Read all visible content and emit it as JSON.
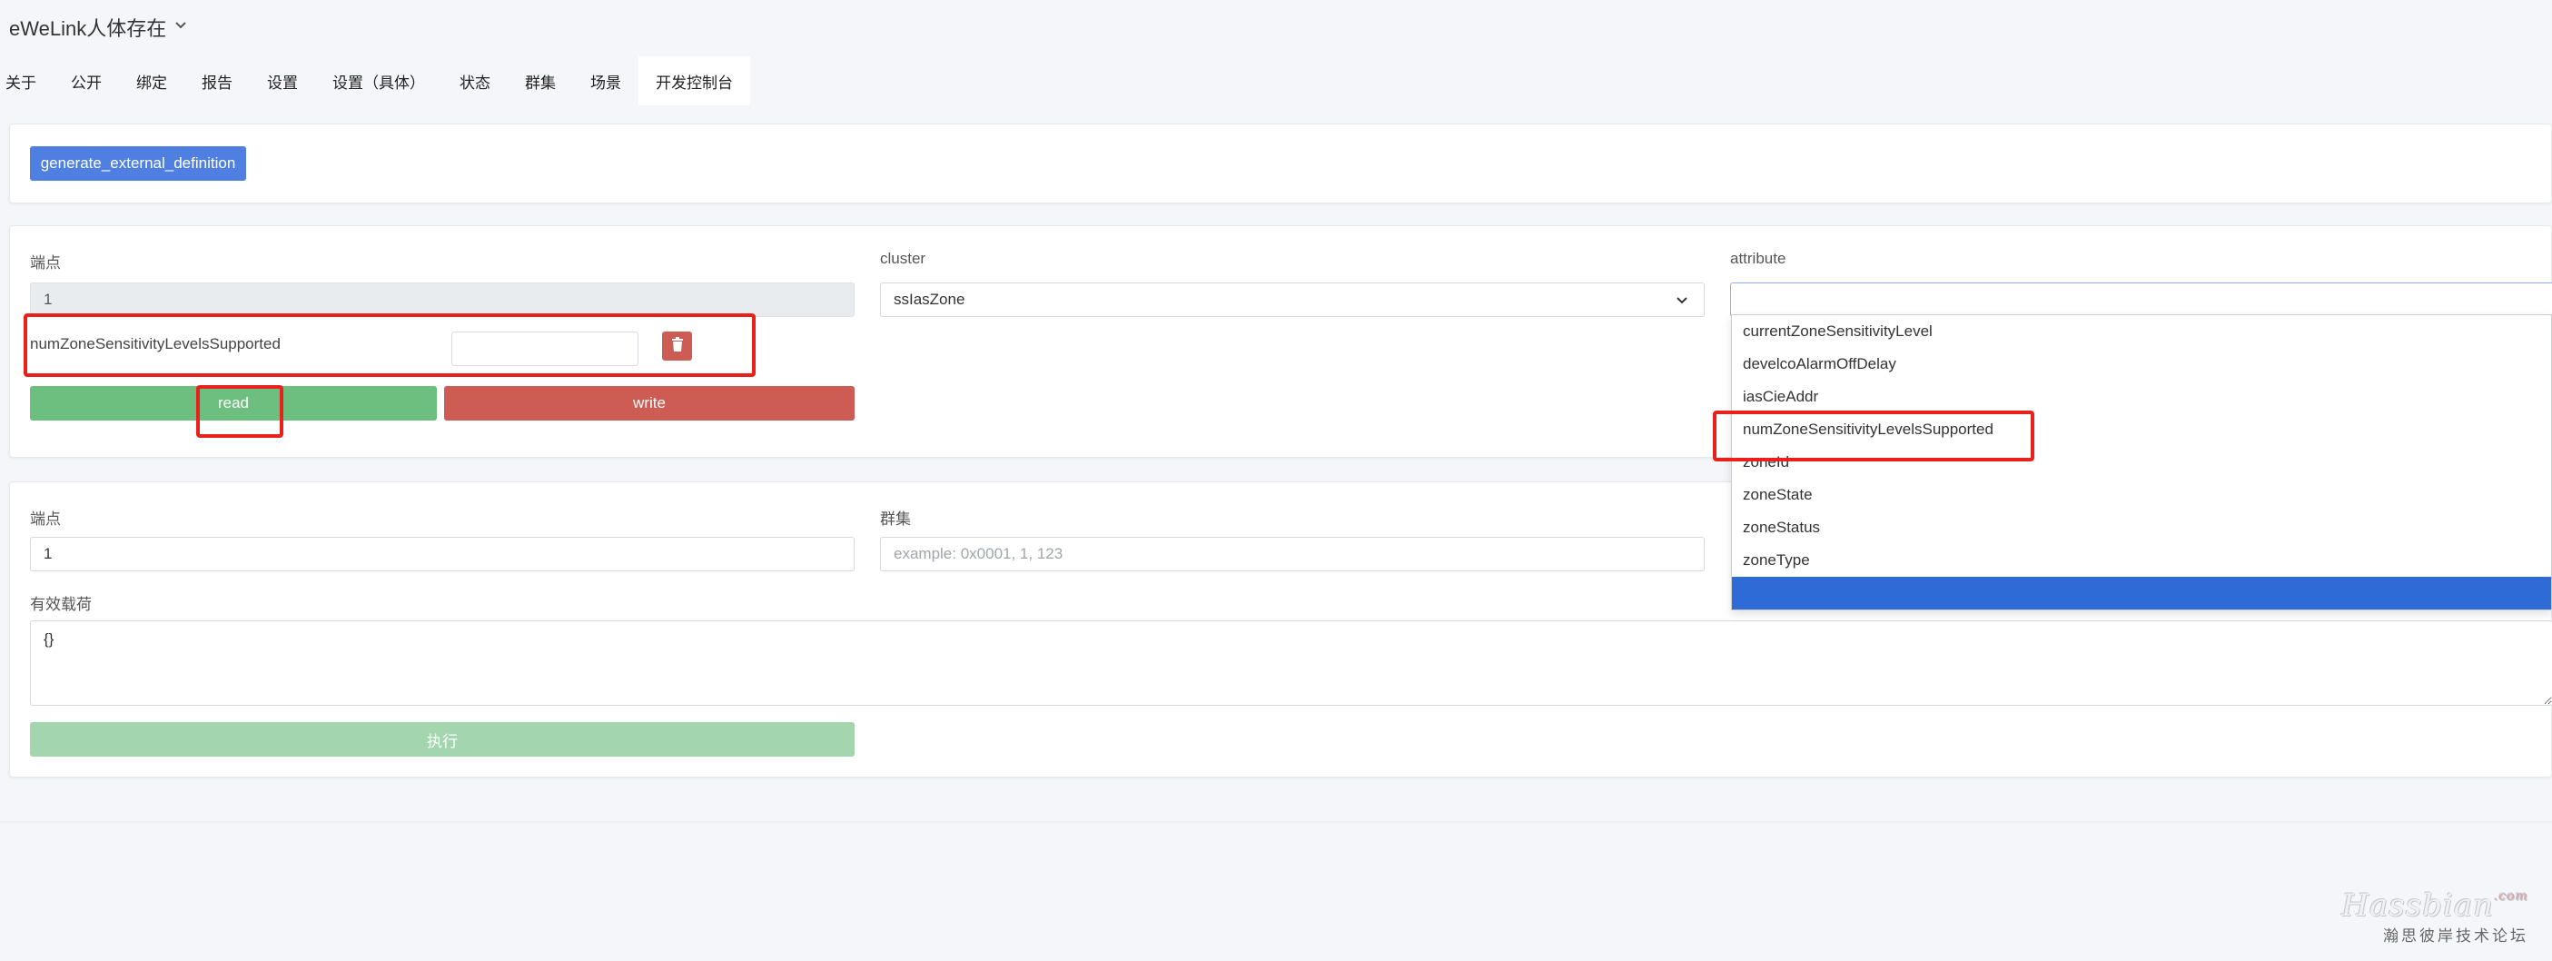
{
  "header": {
    "device_title": "eWeLink人体存在"
  },
  "tabs": [
    {
      "label": "关于"
    },
    {
      "label": "公开"
    },
    {
      "label": "绑定"
    },
    {
      "label": "报告"
    },
    {
      "label": "设置"
    },
    {
      "label": "设置（具体）"
    },
    {
      "label": "状态"
    },
    {
      "label": "群集"
    },
    {
      "label": "场景"
    },
    {
      "label": "开发控制台",
      "active": true
    }
  ],
  "card1": {
    "generate_button_label": "generate_external_definition"
  },
  "attribute_panel": {
    "endpoint_label": "端点",
    "endpoint_value": "1",
    "cluster_label": "cluster",
    "cluster_value": "ssIasZone",
    "attribute_label": "attribute",
    "attribute_value": "",
    "attribute_row_name": "numZoneSensitivityLevelsSupported",
    "attribute_row_value": "",
    "read_label": "read",
    "write_label": "write",
    "dropdown_options": [
      "currentZoneSensitivityLevel",
      "develcoAlarmOffDelay",
      "iasCieAddr",
      "numZoneSensitivityLevelsSupported",
      "zoneId",
      "zoneState",
      "zoneStatus",
      "zoneType",
      ""
    ]
  },
  "command_panel": {
    "endpoint_label": "端点",
    "endpoint_value": "1",
    "cluster_label": "群集",
    "cluster_placeholder": "example: 0x0001, 1, 123",
    "payload_label": "有效载荷",
    "payload_value": "{}",
    "execute_label": "执行"
  },
  "watermark": {
    "brand": "Hassbian",
    "suffix": ".com",
    "tagline": "瀚思彼岸技术论坛"
  },
  "colors": {
    "primary": "#4f80e1",
    "success": "#6cbf7f",
    "danger": "#cd5c55",
    "highlight": "#e8211c",
    "dropdown_selected": "#2f6bd6"
  }
}
